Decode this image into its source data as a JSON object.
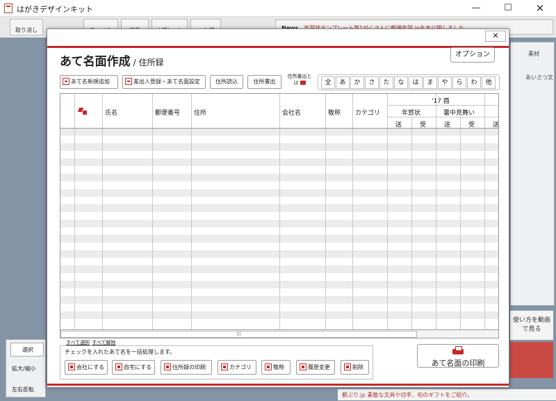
{
  "app": {
    "title": "はがきデザインキット"
  },
  "window_controls": {
    "minimize": "—",
    "maximize": "☐",
    "close": "✕"
  },
  "background": {
    "undo_label": "取り消し",
    "menus": [
      "ファイル",
      "編集",
      "オプション",
      "ヘルプ"
    ],
    "news_label": "News",
    "news_text": "年賀状テンプレート第1がくさんに郵便年賀.jpを本公開しました。",
    "right_panel_label": "素材",
    "right_panel_item": "あいさつ文",
    "promo_text": "使い方を動画で見る",
    "select_tab": "選択",
    "zoom_label": "拡大/縮小",
    "flip_label": "左右反転",
    "bottom_promo": "郵ぷり.jp 素敵な文具や切手、旬のギフトをご紹介。"
  },
  "dialog": {
    "close": "✕",
    "title": "あて名面作成",
    "subtitle": "/ 住所録",
    "option_button": "オプション",
    "toolbar": {
      "add_new": "あて名新規追加",
      "sender_setup": "差出人登録・あて名面設定",
      "import": "住所読込",
      "export": "住所書出",
      "export_to_label": "住所書出とは"
    },
    "kana_filters": [
      "全",
      "あ",
      "か",
      "さ",
      "た",
      "な",
      "は",
      "ま",
      "や",
      "ら",
      "わ",
      "他"
    ],
    "table": {
      "columns": {
        "name": "氏名",
        "postal": "郵便番号",
        "address": "住所",
        "company": "会社名",
        "honorific": "敬称",
        "category": "カテゴリ"
      },
      "year_label": "'17 酉",
      "groups": [
        "年賀状",
        "暑中見舞い"
      ],
      "sent": "送",
      "received": "受",
      "rows": []
    },
    "select_all": "すべて選択",
    "deselect_all": "すべて解除",
    "bulk_instruction": "チェックを入れたあて名を一括処理します。",
    "bulk_buttons": {
      "company": "会社にする",
      "home": "自宅にする",
      "print_list": "住所録の印刷",
      "category": "カテゴリ",
      "honorific": "敬称",
      "history": "履歴変更",
      "delete": "削除"
    },
    "print_button": "あて名面の印刷"
  }
}
